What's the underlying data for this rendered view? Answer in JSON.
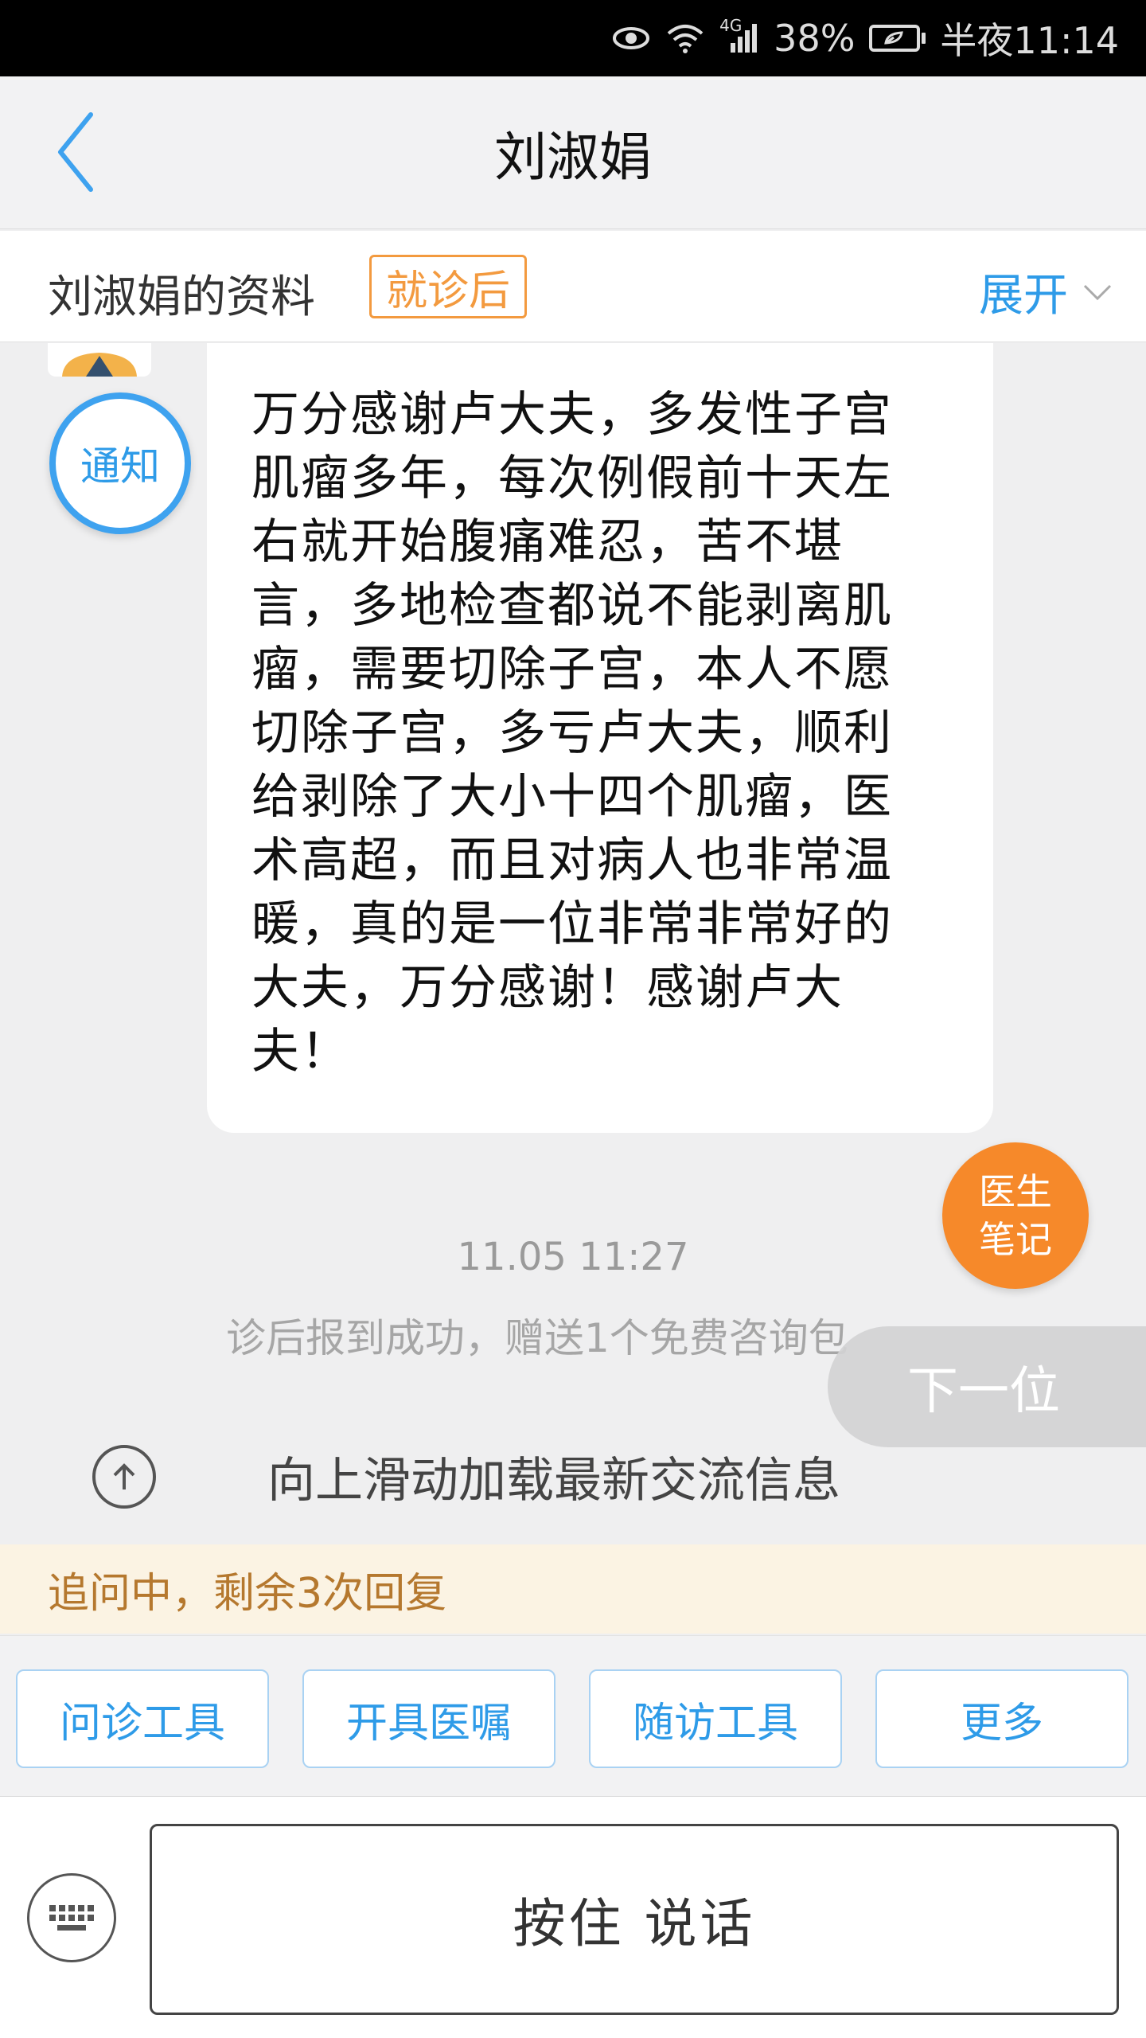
{
  "status_bar": {
    "network": "4G",
    "battery": "38%",
    "time": "半夜11:14"
  },
  "nav": {
    "title": "刘淑娟",
    "back_icon": "chevron-left-icon"
  },
  "profile": {
    "title": "刘淑娟的资料",
    "tag": "就诊后",
    "expand_label": "展开"
  },
  "chat": {
    "notice_label": "通知",
    "message": "万分感谢卢大夫，多发性子宫肌瘤多年，每次例假前十天左右就开始腹痛难忍，苦不堪言，多地检查都说不能剥离肌瘤，需要切除子宫，本人不愿切除子宫，多亏卢大夫，顺利给剥除了大小十四个肌瘤，医术高超，而且对病人也非常温暖，真的是一位非常非常好的大夫，万分感谢！感谢卢大夫！",
    "doctor_notes_line1": "医生",
    "doctor_notes_line2": "笔记",
    "timestamp": "11.05 11:27",
    "system_note": "诊后报到成功，赠送1个免费咨询包",
    "next_label": "下一位",
    "load_more": "向上滑动加载最新交流信息"
  },
  "followup": {
    "text": "追问中，剩余3次回复"
  },
  "tools": [
    {
      "label": "问诊工具"
    },
    {
      "label": "开具医嘱"
    },
    {
      "label": "随访工具"
    },
    {
      "label": "更多"
    }
  ],
  "input": {
    "hold_to_talk": "按住 说话",
    "keyboard_icon": "keyboard-icon"
  },
  "colors": {
    "accent": "#2e9be8",
    "orange": "#f6892a",
    "tag_orange": "#f39a3f",
    "followup_text": "#b5782e",
    "followup_bg": "#fbf3e3"
  }
}
